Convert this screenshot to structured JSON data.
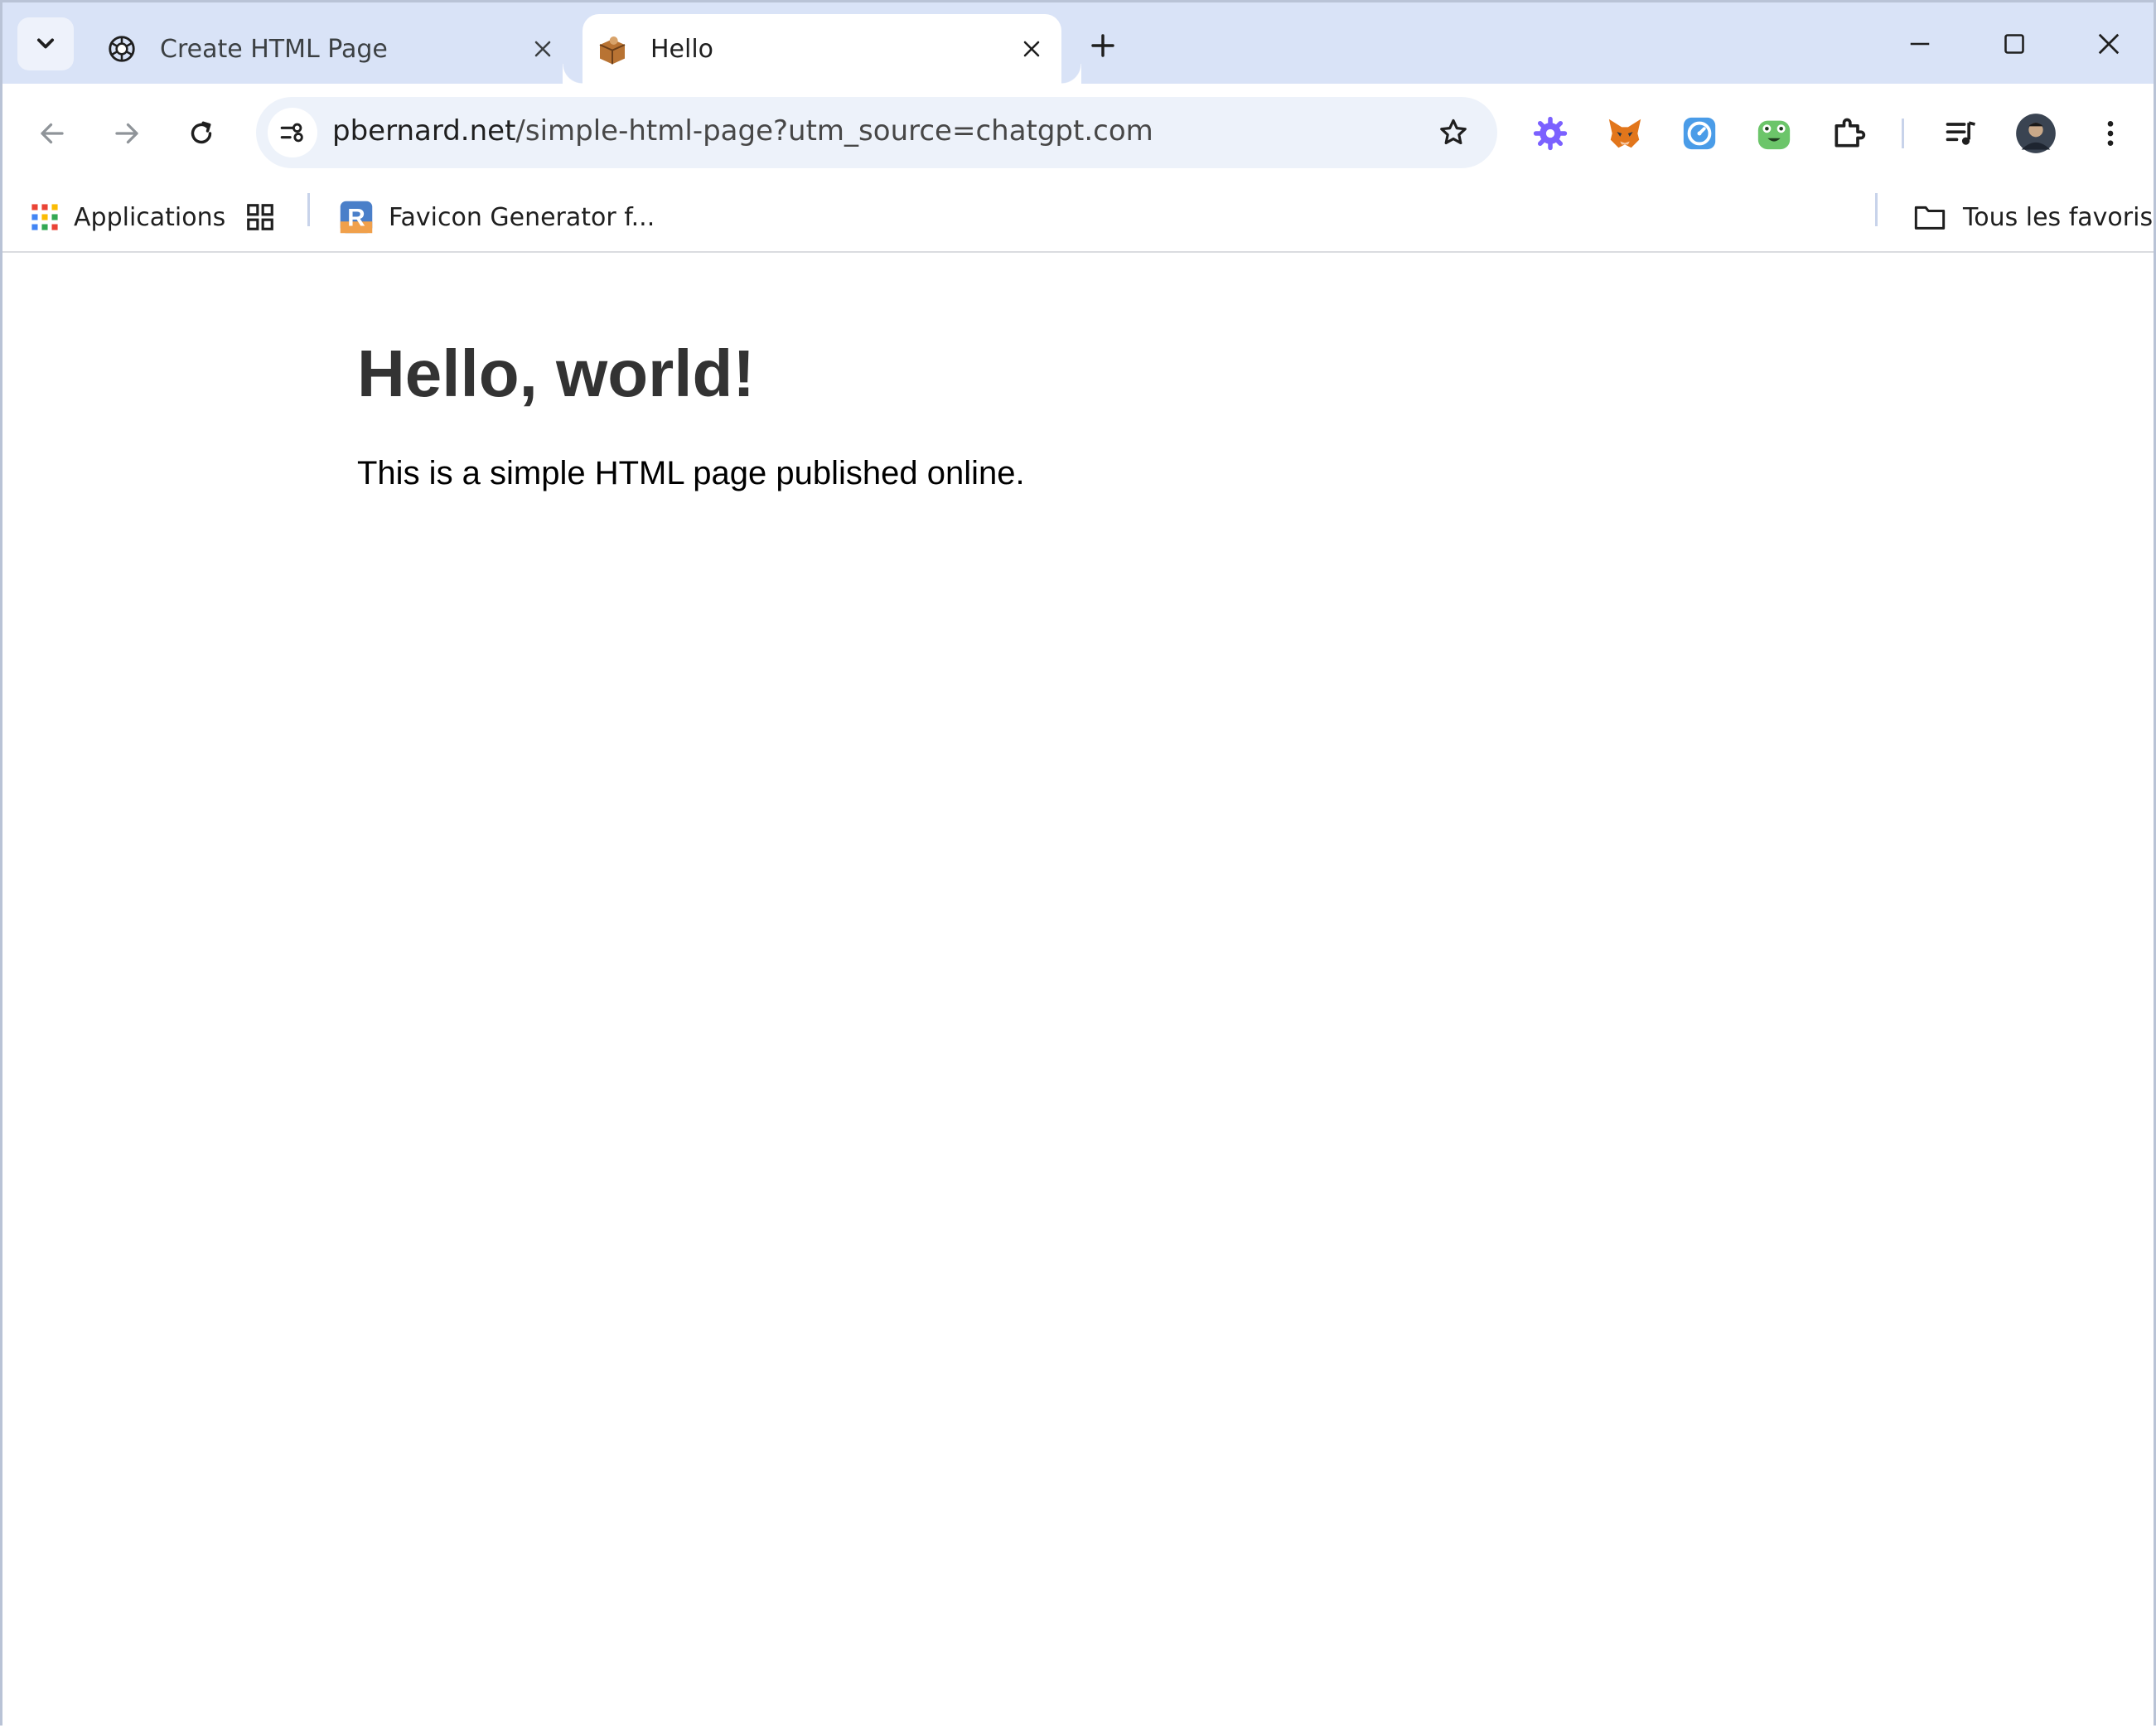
{
  "tabs": [
    {
      "title": "Create HTML Page",
      "favicon": "chatgpt-icon",
      "active": false
    },
    {
      "title": "Hello",
      "favicon": "box-icon",
      "active": true
    }
  ],
  "omnibox": {
    "domain": "pbernard.net",
    "path": "/simple-html-page?utm_source=chatgpt.com"
  },
  "extensions": [
    "gear-extension-icon",
    "metamask-icon",
    "compass-extension-icon",
    "frog-extension-icon",
    "puzzle-extensions-icon",
    "media-controls-icon",
    "profile-avatar",
    "menu-dots-icon"
  ],
  "bookmarks": {
    "apps_label": "Applications",
    "items": [
      {
        "label": "Favicon Generator f...",
        "icon": "r-logo-icon"
      }
    ],
    "all_bookmarks_label": "Tous les favoris"
  },
  "page": {
    "heading": "Hello, world!",
    "paragraph": "This is a simple HTML page published online."
  },
  "colors": {
    "tabstrip": "#d9e3f7",
    "omnibox": "#edf2fa",
    "heading": "#333333"
  }
}
